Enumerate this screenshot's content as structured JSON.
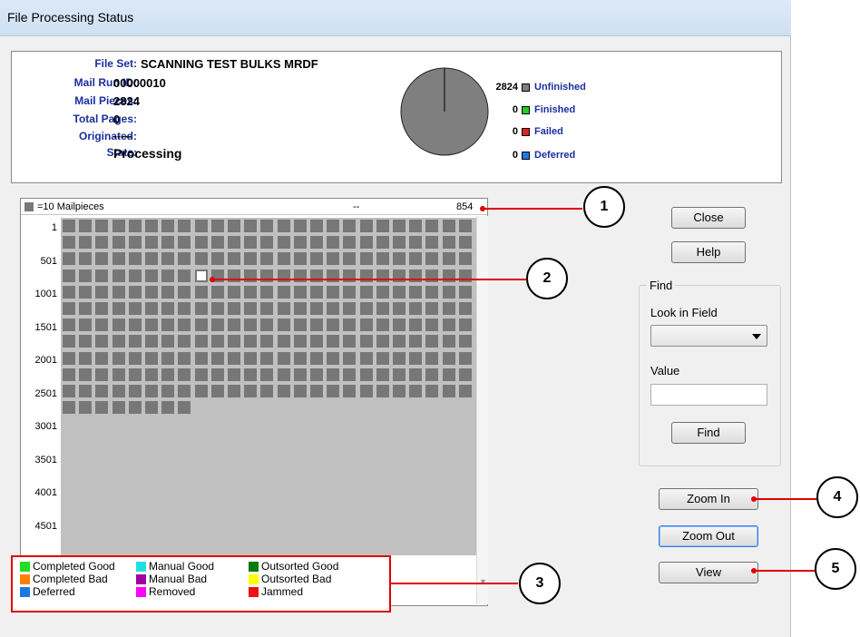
{
  "window": {
    "title": "File Processing Status"
  },
  "summary": {
    "rows": [
      {
        "label": "File Set:",
        "value": "SCANNING TEST BULKS MRDF"
      },
      {
        "label": "Mail Run ID:",
        "value": "00000010"
      },
      {
        "label": "Mail Pieces:",
        "value": "2824"
      },
      {
        "label": "Total Pages:",
        "value": "0"
      },
      {
        "label": "Originated:",
        "value": "-----"
      },
      {
        "label": "State:",
        "value": "Processing"
      }
    ],
    "pie_legend": [
      {
        "count": "2824",
        "label": "Unfinished",
        "color": "#7f7f7f"
      },
      {
        "count": "0",
        "label": "Finished",
        "color": "#22cc22"
      },
      {
        "count": "0",
        "label": "Failed",
        "color": "#e02020"
      },
      {
        "count": "0",
        "label": "Deferred",
        "color": "#1e78e0"
      }
    ]
  },
  "grid": {
    "scale_label": "=10 Mailpieces",
    "dash": "--",
    "hover_value": "854",
    "row_labels": [
      "1",
      "501",
      "1001",
      "1501",
      "2001",
      "2501",
      "3001",
      "3501",
      "4001",
      "4501"
    ],
    "columns": 25,
    "filled_cells": 283,
    "selected_cell": 83
  },
  "legend": [
    {
      "label": "Completed Good",
      "color": "#22dd22"
    },
    {
      "label": "Manual Good",
      "color": "#22e0e0"
    },
    {
      "label": "Outsorted Good",
      "color": "#0a7a0a"
    },
    {
      "label": "Completed Bad",
      "color": "#ff8000"
    },
    {
      "label": "Manual Bad",
      "color": "#a000a0"
    },
    {
      "label": "Outsorted Bad",
      "color": "#ffff00"
    },
    {
      "label": "Deferred",
      "color": "#1e78e0"
    },
    {
      "label": "Removed",
      "color": "#ff00ff"
    },
    {
      "label": "Jammed",
      "color": "#ee1111"
    }
  ],
  "buttons": {
    "close": "Close",
    "help": "Help",
    "find": "Find",
    "zoom_in": "Zoom In",
    "zoom_out": "Zoom Out",
    "view": "View"
  },
  "find_group": {
    "title": "Find",
    "look_in_label": "Look in Field",
    "value_label": "Value",
    "look_in_value": "",
    "value": ""
  },
  "callouts": [
    "1",
    "2",
    "3",
    "4",
    "5"
  ]
}
